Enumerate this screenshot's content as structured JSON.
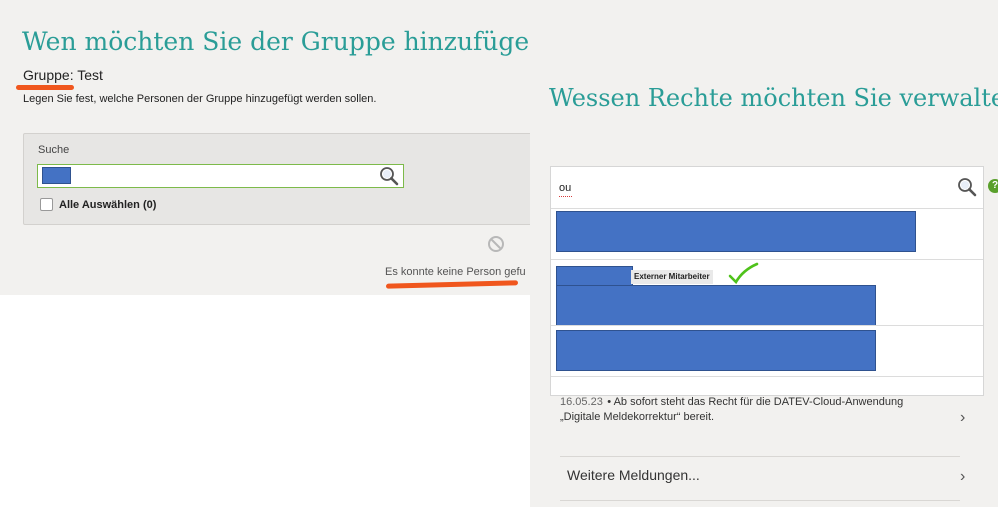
{
  "left": {
    "title": "Wen möchten Sie der Gruppe hinzufügen?",
    "group_label": "Gruppe:",
    "group_name": "Test",
    "subtitle": "Legen Sie fest, welche Personen der Gruppe hinzugefügt werden sollen.",
    "search": {
      "label": "Suche",
      "value": ""
    },
    "select_all_label": "Alle Auswählen (0)",
    "no_result_message": "Es konnte keine Person gefu"
  },
  "right": {
    "title": "Wessen Rechte möchten Sie verwalten?",
    "search_query": "ou",
    "results": [
      {
        "badge": ""
      },
      {
        "badge": "Externer Mitarbeiter"
      },
      {
        "badge": ""
      }
    ],
    "news": {
      "date": "16.05.23",
      "text_line1": "Ab sofort steht das Recht für die DATEV-Cloud-Anwendung",
      "text_line2": "„Digitale Meldekorrektur“ bereit."
    },
    "more_label": "Weitere Meldungen..."
  },
  "colors": {
    "accent_teal": "#2a9d97",
    "annotation_orange": "#f0561d",
    "redaction_blue": "#4472c4",
    "check_green": "#4fc21b",
    "focus_green": "#7dba4a"
  }
}
